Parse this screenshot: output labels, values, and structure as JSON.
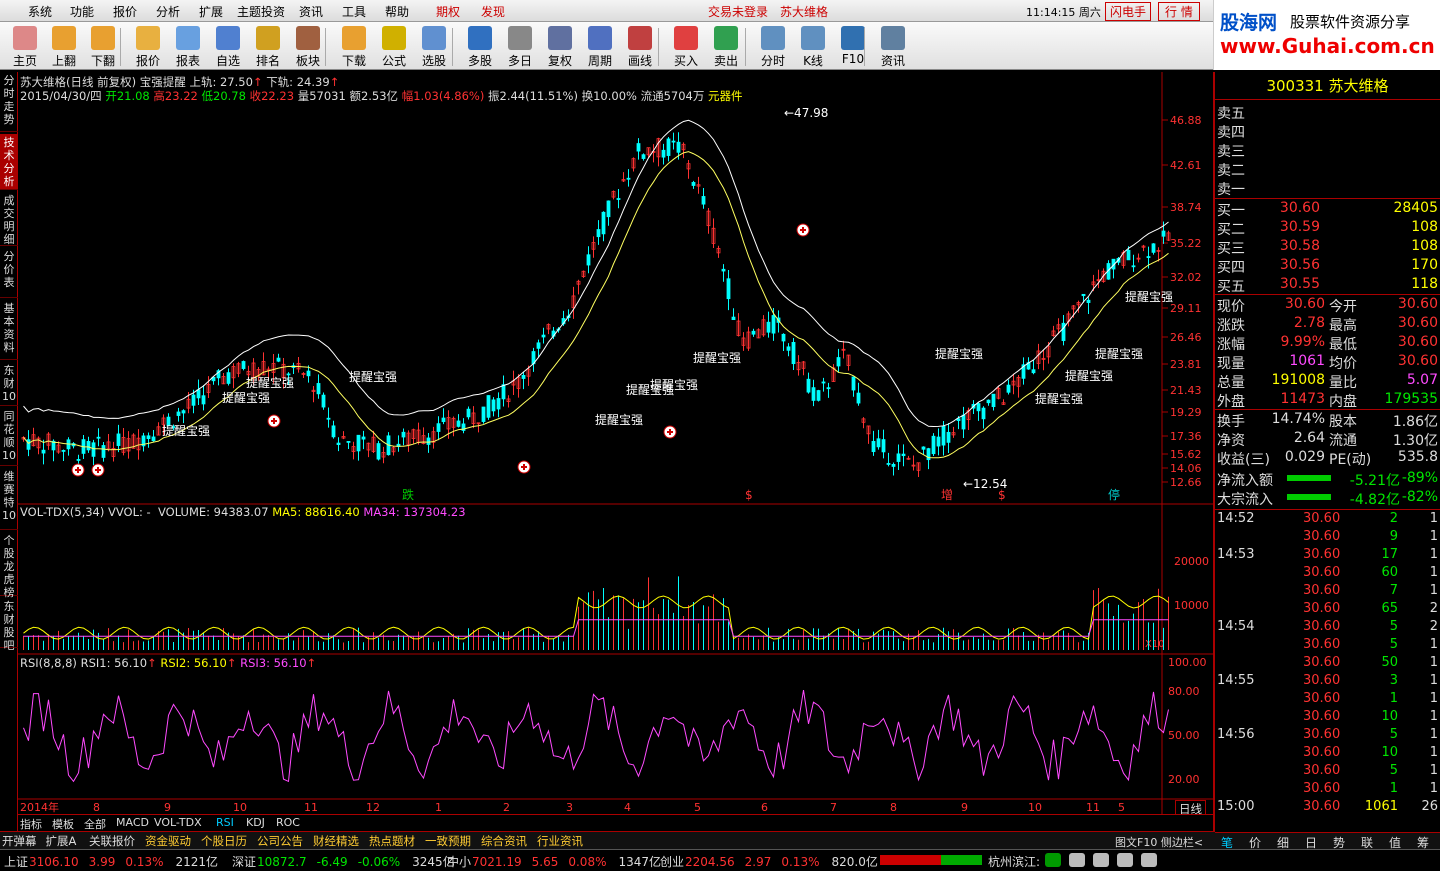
{
  "menu": [
    "系统",
    "功能",
    "报价",
    "分析",
    "扩展",
    "主题投资",
    "资讯",
    "工具",
    "帮助"
  ],
  "menu_red": [
    "期权",
    "发现"
  ],
  "login_status": "交易未登录",
  "stock_name": "苏大维格",
  "clock": "11:14:15 周六",
  "btn_flash": "闪电手",
  "btn_quote": "行 情",
  "toolbar": [
    "主页",
    "上翻",
    "下翻",
    "报价",
    "报表",
    "自选",
    "排名",
    "板块",
    "下载",
    "公式",
    "选股",
    "多股",
    "多日",
    "复权",
    "周期",
    "画线",
    "买入",
    "卖出",
    "分时",
    "K线",
    "F10",
    "资讯"
  ],
  "logo": {
    "main": "股海网",
    "sub": "股票软件资源分享",
    "url": "www.Guhai.com.cn"
  },
  "leftnav": [
    "分时走势",
    "技术分析",
    "成交明细",
    "分价表",
    "基本资料",
    "东财10",
    "同花顺10",
    "维赛特10",
    "个股龙虎榜",
    "东财股吧"
  ],
  "chart": {
    "header1": "苏大维格(日线 前复权) 宝强提醒 上轨: 27.50",
    "header1b": "下轨: 24.39",
    "date": "2015/04/30/四",
    "open_l": "开21.08",
    "high_l": "高23.22",
    "low_l": "低20.78",
    "close_l": "收22.23",
    "vol_l": "量57031",
    "amt_l": "额2.53亿",
    "chg_l": "幅1.03(4.86%)",
    "amp_l": "振2.44(11.51%) 换10.00% 流通5704万",
    "sector_l": "元器件",
    "max_label": "47.98",
    "min_label": "12.54",
    "signal": "提醒宝强",
    "marks": [
      "跌",
      "$",
      "增",
      "$",
      "停"
    ],
    "price_axis": [
      "46.88",
      "42.61",
      "38.74",
      "35.22",
      "32.02",
      "29.11",
      "26.46",
      "23.81",
      "21.43",
      "19.29",
      "17.36",
      "15.62",
      "14.06",
      "12.66"
    ],
    "vol_header": "VOL-TDX(5,34) VVOL: -",
    "vol_v": "VOLUME: 94383.07",
    "vol_ma5": "MA5: 88616.40",
    "vol_ma34": "MA34: 137304.23",
    "vol_axis": [
      "20000",
      "10000"
    ],
    "vol_unit": "X10",
    "rsi_header": "RSI(8,8,8)",
    "rsi1": "RSI1: 56.10",
    "rsi2": "RSI2: 56.10",
    "rsi3": "RSI3: 56.10",
    "rsi_axis": [
      "100.00",
      "80.00",
      "50.00",
      "20.00"
    ],
    "date_axis": [
      "2014年",
      "8",
      "9",
      "10",
      "11",
      "12",
      "1",
      "2",
      "3",
      "4",
      "5",
      "6",
      "7",
      "8",
      "9",
      "10",
      "11",
      "5"
    ],
    "period_btn": "日线"
  },
  "bottom_tabs": [
    "指标",
    "模板",
    "全部",
    "MACD",
    "VOL-TDX",
    "RSI",
    "KDJ",
    "ROC"
  ],
  "bottom_bar": [
    "开弹幕",
    "扩展A",
    "关联报价",
    "资金驱动",
    "个股日历",
    "公司公告",
    "财经精选",
    "热点题材",
    "一致预期",
    "综合资讯",
    "行业资讯"
  ],
  "bottom_right": "图文F10 侧边栏<",
  "right": {
    "code": "300331",
    "name": "苏大维格",
    "sell": [
      "卖五",
      "卖四",
      "卖三",
      "卖二",
      "卖一"
    ],
    "buy": [
      [
        "买一",
        "30.60",
        "28405"
      ],
      [
        "买二",
        "30.59",
        "108"
      ],
      [
        "买三",
        "30.58",
        "108"
      ],
      [
        "买四",
        "30.56",
        "170"
      ],
      [
        "买五",
        "30.55",
        "118"
      ]
    ],
    "quote": [
      [
        "现价",
        "30.60",
        "今开",
        "30.60"
      ],
      [
        "涨跌",
        "2.78",
        "最高",
        "30.60"
      ],
      [
        "涨幅",
        "9.99%",
        "最低",
        "30.60"
      ],
      [
        "现量",
        "1061",
        "均价",
        "30.60"
      ],
      [
        "总量",
        "191008",
        "量比",
        "5.07"
      ],
      [
        "外盘",
        "11473",
        "内盘",
        "179535"
      ]
    ],
    "quote2": [
      [
        "换手",
        "14.74%",
        "股本",
        "1.86亿"
      ],
      [
        "净资",
        "2.64",
        "流通",
        "1.30亿"
      ],
      [
        "收益(三)",
        "0.029",
        "PE(动)",
        "535.8"
      ]
    ],
    "flow": [
      [
        "净流入额",
        "-5.21亿",
        "-89%"
      ],
      [
        "大宗流入",
        "-4.82亿",
        "-82%"
      ]
    ],
    "ticks": [
      [
        "14:52",
        "30.60",
        "2",
        "1"
      ],
      [
        "",
        "30.60",
        "9",
        "1"
      ],
      [
        "14:53",
        "30.60",
        "17",
        "1"
      ],
      [
        "",
        "30.60",
        "60",
        "1"
      ],
      [
        "",
        "30.60",
        "7",
        "1"
      ],
      [
        "",
        "30.60",
        "65",
        "2"
      ],
      [
        "14:54",
        "30.60",
        "5",
        "2"
      ],
      [
        "",
        "30.60",
        "5",
        "1"
      ],
      [
        "",
        "30.60",
        "50",
        "1"
      ],
      [
        "14:55",
        "30.60",
        "3",
        "1"
      ],
      [
        "",
        "30.60",
        "1",
        "1"
      ],
      [
        "",
        "30.60",
        "10",
        "1"
      ],
      [
        "14:56",
        "30.60",
        "5",
        "1"
      ],
      [
        "",
        "30.60",
        "10",
        "1"
      ],
      [
        "",
        "30.60",
        "5",
        "1"
      ],
      [
        "",
        "30.60",
        "1",
        "1"
      ],
      [
        "15:00",
        "30.60",
        "1061",
        "26"
      ]
    ],
    "tabs": [
      "笔",
      "价",
      "细",
      "日",
      "势",
      "联",
      "值",
      "筹"
    ]
  },
  "status": {
    "sh": [
      "上证",
      "3106.10",
      "3.99",
      "0.13%",
      "2121亿"
    ],
    "sz": [
      "深证",
      "10872.7",
      "-6.49",
      "-0.06%",
      "3245亿"
    ],
    "zx": [
      "中小",
      "7021.19",
      "5.65",
      "0.08%",
      "1347亿"
    ],
    "cy": [
      "创业",
      "2204.56",
      "2.97",
      "0.13%",
      "820.0亿"
    ],
    "loc": "杭州滨江:"
  }
}
